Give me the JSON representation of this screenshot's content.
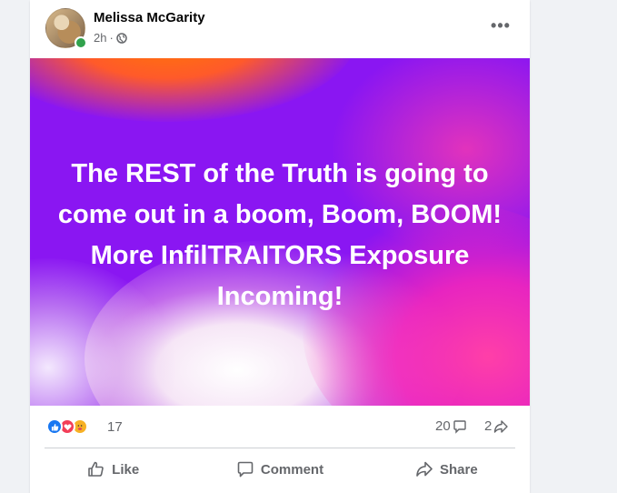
{
  "post": {
    "author": "Melissa McGarity",
    "timestamp": "2h",
    "separator": "·",
    "privacy_icon": "globe-icon",
    "more_icon": "more-dots-icon",
    "more_label": "•••",
    "text": "The REST of the Truth is going to come out in a boom, Boom, BOOM! More InfilTRAITORS Exposure Incoming!",
    "background_colors": [
      "#8a16f2",
      "#ff7a00",
      "#ff2fb3",
      "#ffffff"
    ]
  },
  "stats": {
    "reactions": [
      "like-icon",
      "love-icon",
      "care-icon"
    ],
    "reaction_count": "17",
    "comment_count": "20",
    "share_count": "2"
  },
  "actions": {
    "like_label": "Like",
    "comment_label": "Comment",
    "share_label": "Share"
  },
  "colors": {
    "like_blue": "#1877f2",
    "love_red": "#f33e58",
    "care_yellow": "#f7b125",
    "secondary_text": "#65676b"
  }
}
